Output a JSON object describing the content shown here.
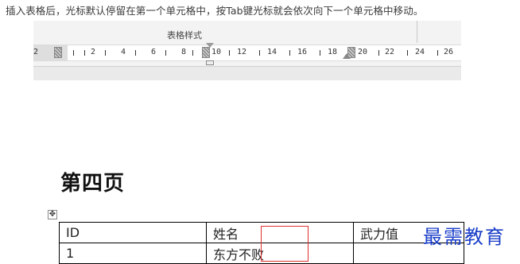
{
  "caption": "插入表格后，光标默认停留在第一个单元格中，按Tab键光标就会依次向下一个单元格中移动。",
  "ribbon": {
    "group_label": "表格样式"
  },
  "ruler": {
    "labels": [
      "2",
      "2",
      "4",
      "6",
      "8",
      "10",
      "12",
      "14",
      "16",
      "18",
      "20",
      "22",
      "24",
      "26"
    ]
  },
  "document": {
    "heading": "第四页",
    "table_handle_icon": "move-table-icon",
    "table": {
      "rows": [
        [
          "ID",
          "姓名",
          "武力值"
        ],
        [
          "1",
          "东方不败",
          ""
        ]
      ]
    }
  },
  "watermark": "最需教育"
}
